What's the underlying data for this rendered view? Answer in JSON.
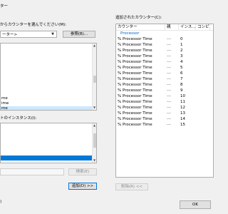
{
  "left": {
    "counters_group_label": "ター",
    "select_from_computer_label": "からカウンターを選んでください(M):",
    "computer_combo_value": "ーター>",
    "browse_button": "参照(B)...",
    "counter_list": [
      "",
      "",
      "",
      "",
      "me",
      "ime",
      "me"
    ],
    "instances_label": "トのインスタンス(I):",
    "instance_list": [
      "",
      "",
      "",
      ""
    ],
    "search_input_value": "",
    "search_button": "検索(E)",
    "add_button": "追加(D) >>"
  },
  "right": {
    "added_counters_label": "追加されたカウンター(C):",
    "columns": [
      "カウンター",
      "親",
      "インス...",
      "コンピュ"
    ],
    "object_name": "Processor",
    "rows": [
      {
        "counter": "% Processor Time",
        "parent": "---",
        "instance": "0"
      },
      {
        "counter": "% Processor Time",
        "parent": "---",
        "instance": "1"
      },
      {
        "counter": "% Processor Time",
        "parent": "---",
        "instance": "2"
      },
      {
        "counter": "% Processor Time",
        "parent": "---",
        "instance": "3"
      },
      {
        "counter": "% Processor Time",
        "parent": "---",
        "instance": "4"
      },
      {
        "counter": "% Processor Time",
        "parent": "---",
        "instance": "5"
      },
      {
        "counter": "% Processor Time",
        "parent": "---",
        "instance": "6"
      },
      {
        "counter": "% Processor Time",
        "parent": "---",
        "instance": "7"
      },
      {
        "counter": "% Processor Time",
        "parent": "---",
        "instance": "8"
      },
      {
        "counter": "% Processor Time",
        "parent": "---",
        "instance": "9"
      },
      {
        "counter": "% Processor Time",
        "parent": "---",
        "instance": "10"
      },
      {
        "counter": "% Processor Time",
        "parent": "---",
        "instance": "11"
      },
      {
        "counter": "% Processor Time",
        "parent": "---",
        "instance": "12"
      },
      {
        "counter": "% Processor Time",
        "parent": "---",
        "instance": "13"
      },
      {
        "counter": "% Processor Time",
        "parent": "---",
        "instance": "14"
      },
      {
        "counter": "% Processor Time",
        "parent": "---",
        "instance": "15"
      }
    ],
    "remove_button": "削除(R) <<"
  },
  "footer": {
    "left_caption": ")",
    "ok_button": "OK"
  },
  "colors": {
    "accent": "#0078d7",
    "object_text": "#0066cc",
    "selection": "#cce8ff"
  }
}
